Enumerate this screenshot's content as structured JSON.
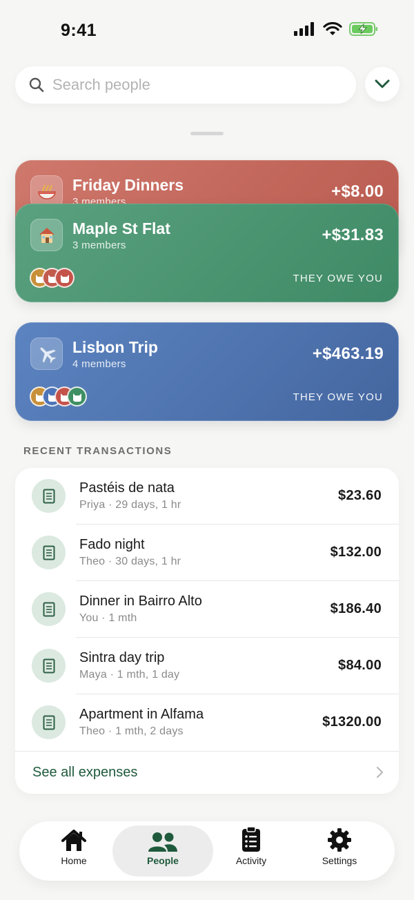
{
  "status_bar": {
    "time": "9:41"
  },
  "search": {
    "placeholder": "Search people"
  },
  "groups": [
    {
      "name": "Friday Dinners",
      "members": "3 members",
      "amount": "+$8.00",
      "icon": "noodle-bowl-icon"
    },
    {
      "name": "Maple St Flat",
      "members": "3 members",
      "amount": "+$31.83",
      "status": "THEY OWE YOU",
      "icon": "house-icon"
    },
    {
      "name": "Lisbon Trip",
      "members": "4 members",
      "amount": "+$463.19",
      "status": "THEY OWE YOU",
      "icon": "airplane-icon"
    }
  ],
  "recent": {
    "title": "RECENT TRANSACTIONS",
    "items": [
      {
        "title": "Pastéis de nata",
        "who": "Priya",
        "when": "29 days, 1 hr",
        "amount": "$23.60"
      },
      {
        "title": "Fado night",
        "who": "Theo",
        "when": "30 days, 1 hr",
        "amount": "$132.00"
      },
      {
        "title": "Dinner in Bairro Alto",
        "who": "You",
        "when": "1 mth",
        "amount": "$186.40"
      },
      {
        "title": "Sintra day trip",
        "who": "Maya",
        "when": "1 mth, 1 day",
        "amount": "$84.00"
      },
      {
        "title": "Apartment in Alfama",
        "who": "Theo",
        "when": "1 mth, 2 days",
        "amount": "$1320.00"
      }
    ],
    "see_all": "See all expenses"
  },
  "tabs": [
    {
      "label": "Home",
      "icon": "home-icon"
    },
    {
      "label": "People",
      "icon": "people-icon",
      "active": true
    },
    {
      "label": "Activity",
      "icon": "clipboard-icon"
    },
    {
      "label": "Settings",
      "icon": "gear-icon"
    }
  ],
  "colors": {
    "accent": "#1f5a3c",
    "card_red": "#c4675c",
    "card_green": "#4c9673",
    "card_blue": "#4f74b0",
    "receipt_bg": "#dbe9e0"
  }
}
